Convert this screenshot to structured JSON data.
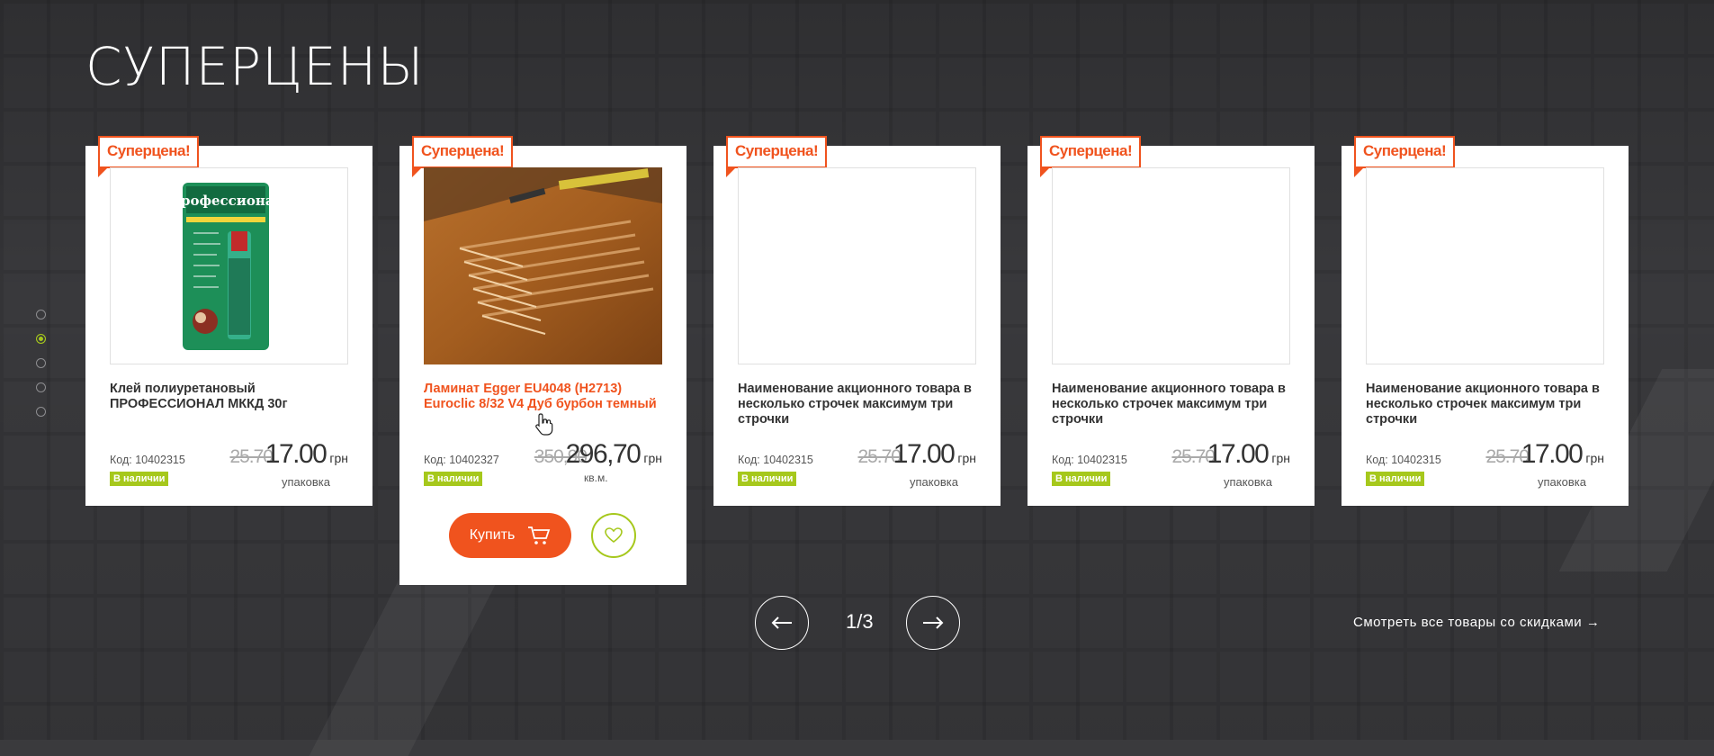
{
  "section_title": "СУПЕРЦЕНЫ",
  "colors": {
    "accent": "#f0531e",
    "green": "#a6c81c",
    "background": "#39393c"
  },
  "carousel": {
    "page_indicator": "1/3",
    "prev_icon": "arrow-left-icon",
    "next_icon": "arrow-right-icon",
    "active_dot": 1,
    "dots": 5
  },
  "view_all_link": "Смотреть все товары со скидками →",
  "products": [
    {
      "badge": "Суперцена!",
      "name": "Клей полиуретановый ПРОФЕССИОНАЛ МККД 30г",
      "code": "Код: 10402315",
      "stock": "В наличии",
      "old_price": "25.70",
      "price": "17.00",
      "currency": "грн",
      "unit": "упаковка"
    },
    {
      "badge": "Суперцена!",
      "name": "Ламинат Egger EU4048 (H2713) Euroclic 8/32 V4 Дуб бурбон темный",
      "code": "Код: 10402327",
      "stock": "В наличии",
      "old_price": "350,90",
      "price": "296,70",
      "currency": "грн",
      "unit": "кв.м.",
      "buy_label": "Купить"
    },
    {
      "badge": "Суперцена!",
      "name": "Наименование акционного товара в несколько строчек максимум три строчки",
      "code": "Код: 10402315",
      "stock": "В наличии",
      "old_price": "25.70",
      "price": "17.00",
      "currency": "грн",
      "unit": "упаковка"
    },
    {
      "badge": "Суперцена!",
      "name": "Наименование акционного товара в несколько строчек максимум три строчки",
      "code": "Код: 10402315",
      "stock": "В наличии",
      "old_price": "25.70",
      "price": "17.00",
      "currency": "грн",
      "unit": "упаковка"
    },
    {
      "badge": "Суперцена!",
      "name": "Наименование акционного товара в несколько строчек максимум три строчки",
      "code": "Код: 10402315",
      "stock": "В наличии",
      "old_price": "25.70",
      "price": "17.00",
      "currency": "грн",
      "unit": "упаковка"
    }
  ],
  "glue_package": {
    "brand": "Профессионал"
  }
}
